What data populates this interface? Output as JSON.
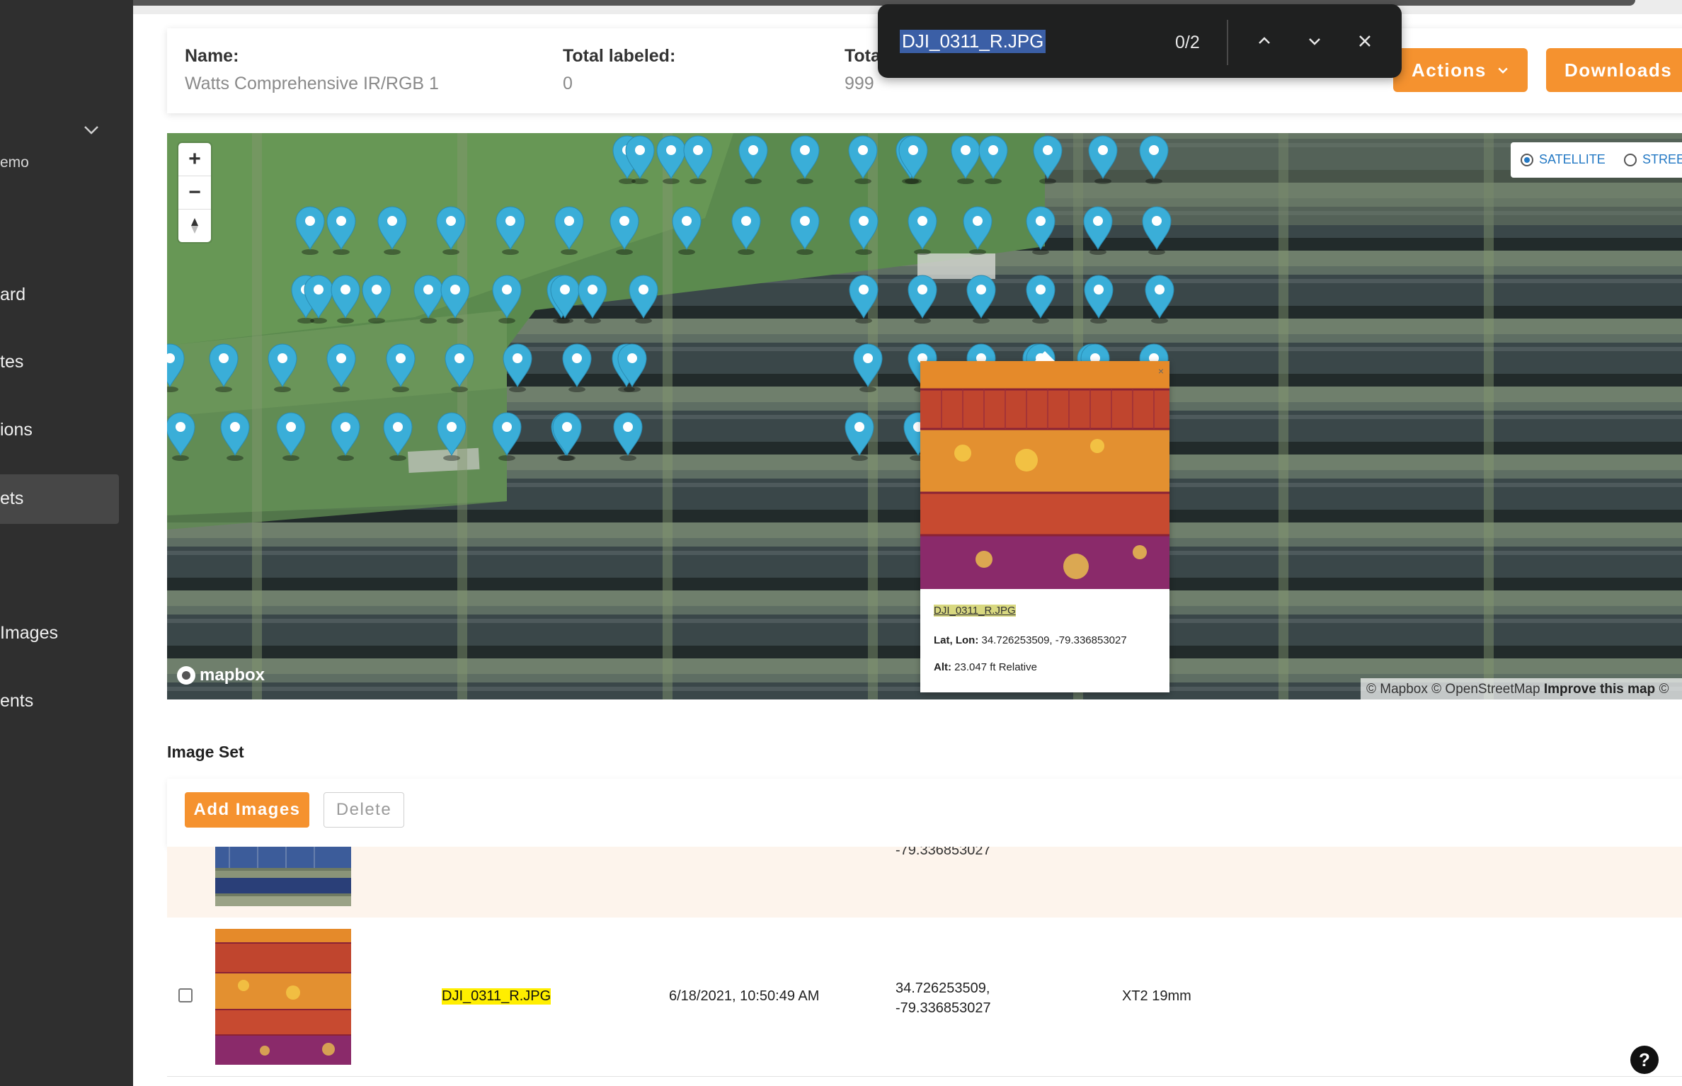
{
  "sidebar": {
    "org_name": "emo",
    "items": [
      {
        "label": "ard"
      },
      {
        "label": "tes"
      },
      {
        "label": "ions"
      },
      {
        "label": "ets"
      },
      {
        "label": "Images"
      },
      {
        "label": "ents"
      }
    ],
    "active_index": 3
  },
  "header": {
    "name_label": "Name:",
    "name_value": "Watts Comprehensive IR/RGB 1",
    "labeled_label": "Total labeled:",
    "labeled_value": "0",
    "total_label": "Tota",
    "total_value": "999",
    "actions_label": "Actions",
    "downloads_label": "Downloads"
  },
  "find_bar": {
    "query": "DJI_0311_R.JPG",
    "count": "0/2"
  },
  "map": {
    "zoom_in": "+",
    "zoom_out": "−",
    "style_options": [
      "SATELLITE",
      "STREE"
    ],
    "selected_style": "SATELLITE",
    "logo_text": "mapbox",
    "attribution_text": "© Mapbox © OpenStreetMap",
    "improve_text": "Improve this map",
    "attribution_tail": "©",
    "marker_color": "#3aaed8",
    "popup": {
      "filename": "DJI_0311_R.JPG",
      "latlon_label": "Lat, Lon:",
      "latlon_value": "34.726253509, -79.336853027",
      "alt_label": "Alt:",
      "alt_value": "23.047 ft Relative"
    }
  },
  "image_set": {
    "title": "Image Set",
    "add_label": "Add Images",
    "delete_label": "Delete",
    "prev_row": {
      "coords_tail": "-79.336853027"
    },
    "rows": [
      {
        "filename": "DJI_0311_R.JPG",
        "date": "6/18/2021, 10:50:49 AM",
        "lat": "34.726253509,",
        "lon": "-79.336853027",
        "camera": "XT2 19mm"
      }
    ]
  },
  "help_label": "?",
  "colors": {
    "accent": "#f5922f",
    "sidebar_bg": "#2f2f2f",
    "highlight": "#ffee00",
    "find_selection": "#3b5fa6"
  }
}
